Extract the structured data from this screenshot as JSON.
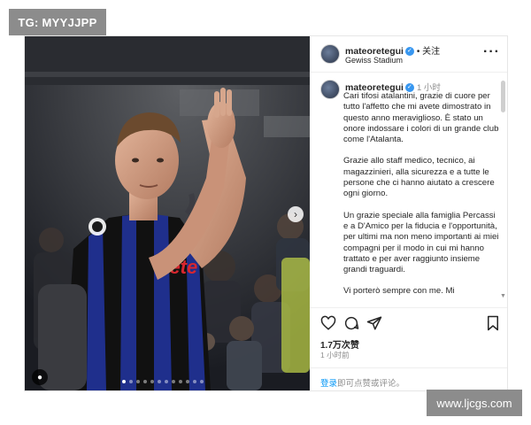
{
  "watermark_top": "TG: MYYJJPP",
  "watermark_bottom": "www.ljcgs.com",
  "header": {
    "username": "mateoretegui",
    "follow": "关注",
    "location": "Gewiss Stadium",
    "more_icon": "more-icon"
  },
  "caption": {
    "username": "mateoretegui",
    "time": "1 小时",
    "paragraphs": [
      "Cari tifosi atalantini, grazie di cuore per tutto l'affetto che mi avete dimostrato in questo anno meraviglioso. È stato un onore indossare i colori di un grande club come l'Atalanta.",
      "Grazie allo staff medico, tecnico, ai magazzinieri, alla sicurezza e a tutte le persone che ci hanno aiutato a crescere ogni giorno.",
      "Un grazie speciale alla famiglia Percassi e a D'Amico per la fiducia e l'opportunità, per ultimi ma non meno importanti ai miei compagni per il modo in cui mi hanno trattato e per aver raggiunto insieme grandi traguardi.",
      "Vi porterò sempre con me. Mi"
    ]
  },
  "stats": {
    "likes": "1.7万次赞",
    "posted": "1 小时前"
  },
  "login": {
    "link": "登录",
    "rest": "即可点赞或评论。"
  },
  "photo": {
    "jersey_sponsor": "Lete",
    "carousel_total": 12,
    "carousel_active": 1
  },
  "colors": {
    "verified": "#3897f0",
    "link": "#0095f6",
    "jersey_blue": "#1f2f8c",
    "jersey_black": "#111111"
  }
}
